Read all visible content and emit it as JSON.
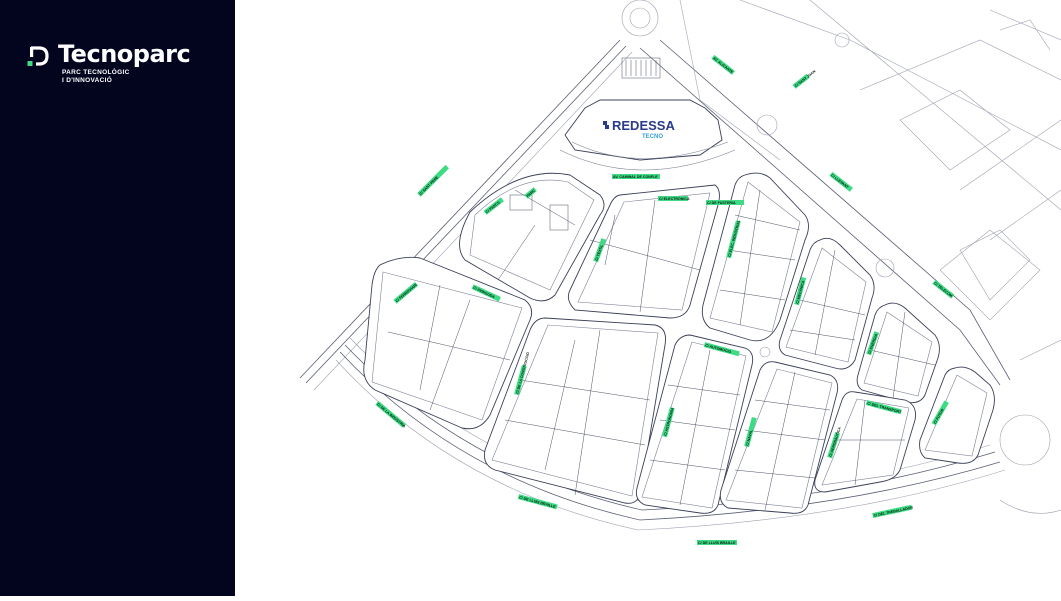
{
  "brand": {
    "name": "Tecnoparc",
    "tagline_line1": "PARC TECNOLÒGIC",
    "tagline_line2": "I D'INNOVACIÓ",
    "accent_color": "#3ddc84",
    "sidebar_color": "#03051f"
  },
  "building": {
    "name": "REDESSA",
    "sub": "TECNO",
    "color": "#2a3a8c",
    "sub_color": "#3aa0d8"
  },
  "street_labels": [
    "C/ SANT PERE",
    "AV. ALICANTE",
    "C/ SANT JOAN",
    "C/ LLEVANT",
    "AV. CAMINAL DE CONFLE",
    "C/ PARCS",
    "PARC",
    "C/ TÈXTIL",
    "C/ ELECTRÒNICA",
    "C/ DE FUSTERIA",
    "C/ ELEC. INDUSTRIAL",
    "C/ MECÀNICA",
    "C/ FERROVIARI",
    "C/ AVINGUDA",
    "C/ AUTOMOCIÓ",
    "C/ ENERGIA",
    "C/ TELECOM",
    "C/ DE LA CONSTRUCCIÓ",
    "C/ ASTRONOMIA",
    "C/ NAVAL",
    "C/ AERONÀUTICA",
    "C/ FUTUR",
    "C/ DEL TRANSPORT",
    "C/ DE LA INDÚSTRIA",
    "C/ DE LLUÍS BRAILLE",
    "C/ DEL TREBALLADOR"
  ]
}
